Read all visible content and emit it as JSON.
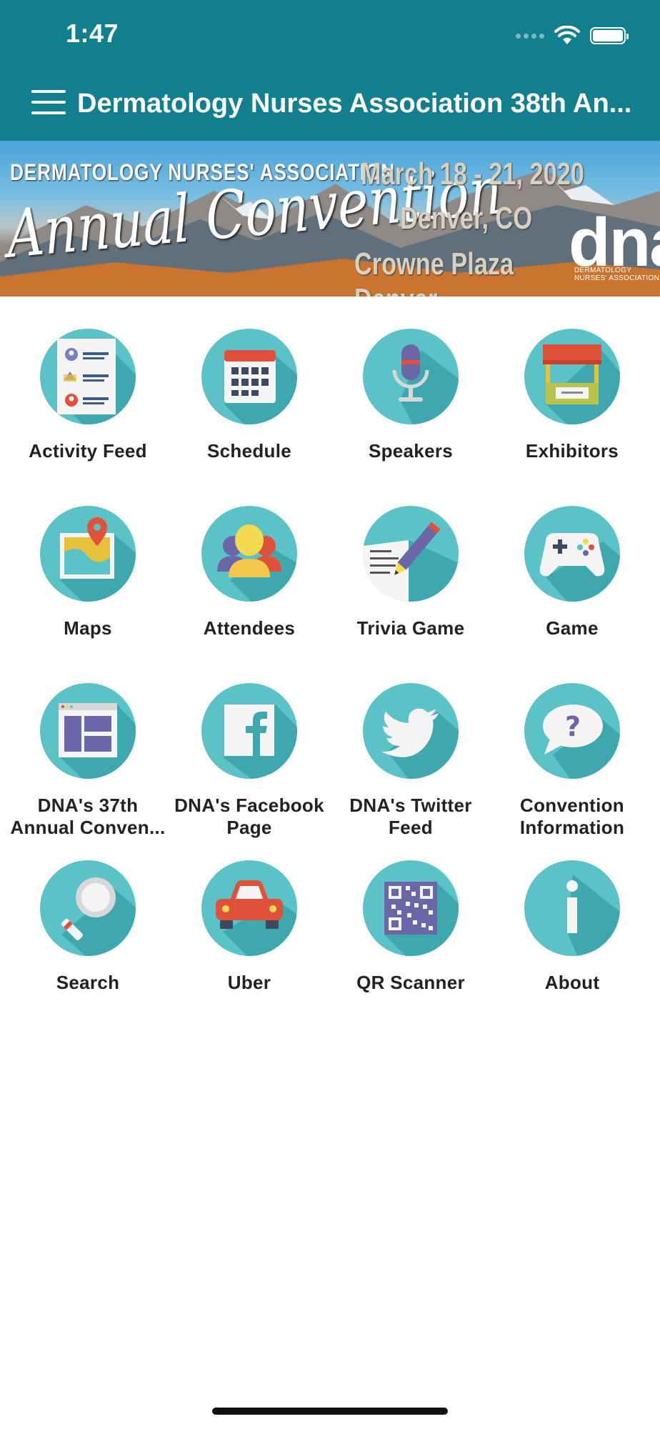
{
  "status_bar": {
    "time": "1:47",
    "wifi_icon": "wifi-icon",
    "battery_icon": "battery-icon"
  },
  "header": {
    "title": "Dermatology Nurses Association 38th An...",
    "menu_icon": "hamburger-menu-icon"
  },
  "banner": {
    "org": "DERMATOLOGY NURSES' ASSOCIATION",
    "event": "Annual Convention",
    "dates": "March 18 - 21, 2020",
    "city": "Denver, CO",
    "venue": "Crowne Plaza Denver",
    "logo": "dna",
    "logo_sub": "DERMATOLOGY NURSES' ASSOCIATION"
  },
  "colors": {
    "header": "#127f8f",
    "icon_circle": "#5bc2c8",
    "icon_shadow": "#3fa8ae"
  },
  "tiles": [
    {
      "label": "Activity Feed",
      "icon": "activity-feed-icon"
    },
    {
      "label": "Schedule",
      "icon": "calendar-icon"
    },
    {
      "label": "Speakers",
      "icon": "microphone-icon"
    },
    {
      "label": "Exhibitors",
      "icon": "booth-icon"
    },
    {
      "label": "Maps",
      "icon": "map-icon"
    },
    {
      "label": "Attendees",
      "icon": "people-icon"
    },
    {
      "label": "Trivia Game",
      "icon": "pencil-paper-icon"
    },
    {
      "label": "Game",
      "icon": "gamepad-icon"
    },
    {
      "label": "DNA's 37th\nAnnual Conven...",
      "icon": "webpage-icon"
    },
    {
      "label": "DNA's Facebook\nPage",
      "icon": "facebook-icon"
    },
    {
      "label": "DNA's Twitter\nFeed",
      "icon": "twitter-icon"
    },
    {
      "label": "Convention\nInformation",
      "icon": "question-bubble-icon"
    },
    {
      "label": "Search",
      "icon": "magnifier-icon"
    },
    {
      "label": "Uber",
      "icon": "car-icon"
    },
    {
      "label": "QR Scanner",
      "icon": "qr-code-icon"
    },
    {
      "label": "About",
      "icon": "info-icon"
    }
  ]
}
